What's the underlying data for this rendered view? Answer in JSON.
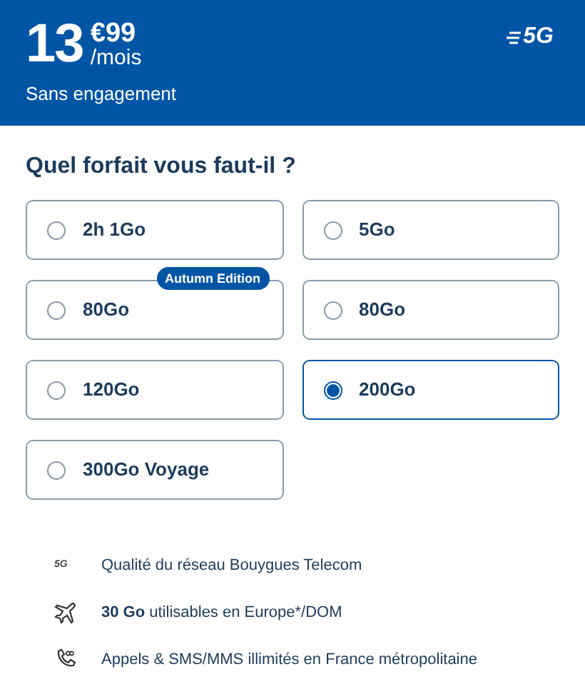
{
  "header": {
    "price_whole": "13",
    "price_cents": "€99",
    "period": "/mois",
    "commitment": "Sans engagement",
    "network_badge": "5G"
  },
  "question": "Quel forfait vous faut-il ?",
  "plans": [
    {
      "label": "2h 1Go",
      "selected": false
    },
    {
      "label": "5Go",
      "selected": false
    },
    {
      "label": "80Go",
      "selected": false,
      "badge": "Autumn Edition"
    },
    {
      "label": "80Go",
      "selected": false
    },
    {
      "label": "120Go",
      "selected": false
    },
    {
      "label": "200Go",
      "selected": true
    },
    {
      "label": "300Go Voyage",
      "selected": false
    }
  ],
  "features": [
    {
      "kind": "network",
      "icon_text": "5G",
      "text": "Qualité du réseau Bouygues Telecom"
    },
    {
      "kind": "plane",
      "text": "**30 Go** utilisables en Europe*/DOM"
    },
    {
      "kind": "phone",
      "text": "Appels & SMS/MMS illimités en France métropolitaine"
    }
  ]
}
